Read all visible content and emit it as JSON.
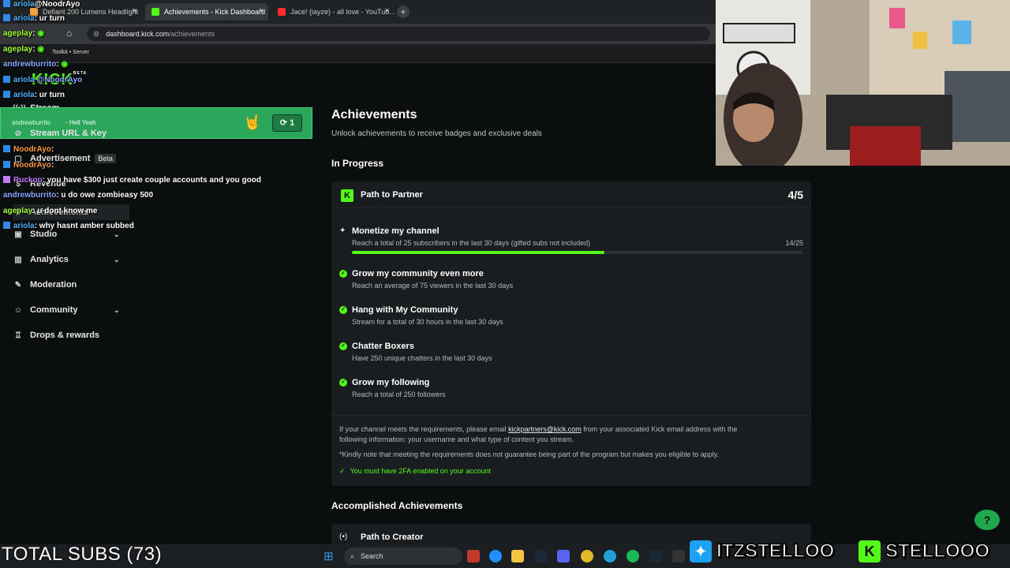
{
  "browser": {
    "tabs": [
      {
        "title": "Defiant 200 Lumens Headlight",
        "active": false
      },
      {
        "title": "Achievements - Kick Dashboard",
        "active": true
      },
      {
        "title": "Jace! (iayze) - all love - YouTub...",
        "active": false
      }
    ],
    "url_host": "dashboard.kick.com",
    "url_path": "/achievements",
    "bookmark": "Toolkit • Server"
  },
  "kick_logo": "KICK",
  "kick_logo_tag": "BETA",
  "sidebar": {
    "items": [
      {
        "label": "Stream",
        "icon": "broadcast-icon"
      },
      {
        "label": "Stream URL & Key",
        "icon": "link-icon"
      },
      {
        "label": "Advertisement",
        "badge": "Beta",
        "icon": "ad-icon"
      },
      {
        "label": "Revenue",
        "icon": "revenue-icon"
      },
      {
        "label": "Achievements",
        "icon": "trophy-icon"
      },
      {
        "label": "Studio",
        "icon": "studio-icon"
      },
      {
        "label": "Analytics",
        "icon": "chart-icon"
      },
      {
        "label": "Moderation",
        "icon": "wrench-icon"
      },
      {
        "label": "Community",
        "icon": "people-icon"
      },
      {
        "label": "Drops & rewards",
        "icon": "gift-icon"
      }
    ]
  },
  "alert": {
    "user": "andrewburrito",
    "message": "- Hell Yeah",
    "count": "1"
  },
  "chat": [
    {
      "user": "ariola",
      "color": "#4fb3ff",
      "msg": ": ur turn",
      "badge": "blue"
    },
    {
      "user": "ageplay",
      "color": "#a7ff3a",
      "msg": ":",
      "badge": "none"
    },
    {
      "user": "ageplay",
      "color": "#a7ff3a",
      "msg": ":",
      "badge": "none"
    },
    {
      "user": "andrewburrito",
      "color": "#8aa8ff",
      "msg": ":",
      "badge": "none"
    },
    {
      "user": "ariola",
      "color": "#4fb3ff",
      "msg": "@NoodrAyo",
      "badge": "blue"
    },
    {
      "user": "ariola",
      "color": "#4fb3ff",
      "msg": ": ur turn",
      "badge": "blue"
    },
    {
      "user": "NoodrAyo",
      "color": "#ff9b3d",
      "msg": ":",
      "badge": "blue"
    },
    {
      "user": "NoodrAyo",
      "color": "#ff9b3d",
      "msg": ":",
      "badge": "blue"
    },
    {
      "user": "Ruckoo",
      "color": "#c47bff",
      "msg": ": you have $300 just create couple accounts and you good",
      "badge": "none"
    },
    {
      "user": "andrewburrito",
      "color": "#8aa8ff",
      "msg": ": u do owe zombieasy 500",
      "badge": "none"
    },
    {
      "user": "ageplay",
      "color": "#a7ff3a",
      "msg": ": u dont know me",
      "badge": "none"
    },
    {
      "user": "ariola",
      "color": "#4fb3ff",
      "msg": ": why hasnt amber subbed",
      "badge": "blue"
    }
  ],
  "main": {
    "title": "Achievements",
    "subtitle": "Unlock achievements to receive badges and exclusive deals",
    "in_progress_title": "In Progress",
    "card": {
      "title": "Path to Partner",
      "progress": "4/5",
      "achievements": [
        {
          "title": "Monetize my channel",
          "desc": "Reach a total of 25 subscribers in the last 30 days (gifted subs not included)",
          "status": "in_progress",
          "progress_text": "14/25",
          "progress_fraction": 0.56
        },
        {
          "title": "Grow my community even more",
          "desc": "Reach an average of 75 viewers in the last 30 days",
          "status": "done"
        },
        {
          "title": "Hang with My Community",
          "desc": "Stream for a total of 30 hours in the last 30 days",
          "status": "done"
        },
        {
          "title": "Chatter Boxers",
          "desc": "Have 250 unique chatters in the last 30 days",
          "status": "done"
        },
        {
          "title": "Grow my following",
          "desc": "Reach a total of 250 followers",
          "status": "done"
        }
      ],
      "footer_line1_a": "If your channel meets the requirements, please email ",
      "footer_email": "kickpartners@kick.com",
      "footer_line1_b": " from your associated Kick email address with the",
      "footer_line2": "following information: your username and what type of content you stream.",
      "footer_note": "*Kindly note that meeting the requirements does not guarantee being part of the program but makes you eligible to apply.",
      "footer_2fa": "You must have 2FA enabled on your account"
    },
    "accomplished_title": "Accomplished Achievements",
    "creator_card_title": "Path to Creator"
  },
  "overlay": {
    "total_subs": "TOTAL SUBS (73)",
    "twitter_handle": "ITZSTELLOO",
    "kick_handle": "STELLOOO"
  },
  "taskbar": {
    "search_placeholder": "Search"
  },
  "colors": {
    "kick_green": "#53fc18",
    "bg": "#0b0e0f",
    "card": "#191d1f"
  }
}
